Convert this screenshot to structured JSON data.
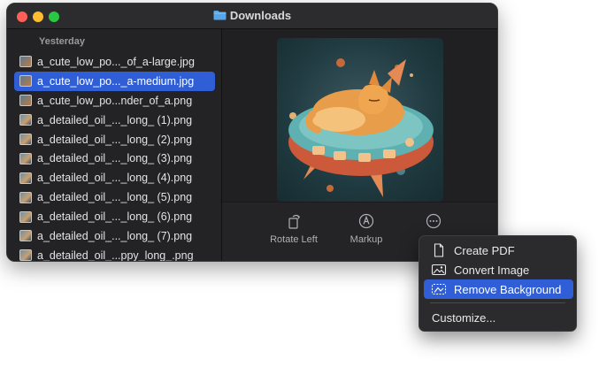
{
  "window": {
    "title": "Downloads"
  },
  "sidebar": {
    "section": "Yesterday",
    "files": [
      {
        "name": "a_cute_low_po..._of_a-large.jpg",
        "selected": false,
        "thumb": "cat"
      },
      {
        "name": "a_cute_low_po..._a-medium.jpg",
        "selected": true,
        "thumb": "cat"
      },
      {
        "name": "a_cute_low_po...nder_of_a.png",
        "selected": false,
        "thumb": "cat"
      },
      {
        "name": "a_detailed_oil_..._long_ (1).png",
        "selected": false,
        "thumb": "oil"
      },
      {
        "name": "a_detailed_oil_..._long_ (2).png",
        "selected": false,
        "thumb": "oil"
      },
      {
        "name": "a_detailed_oil_..._long_ (3).png",
        "selected": false,
        "thumb": "oil"
      },
      {
        "name": "a_detailed_oil_..._long_ (4).png",
        "selected": false,
        "thumb": "oil"
      },
      {
        "name": "a_detailed_oil_..._long_ (5).png",
        "selected": false,
        "thumb": "oil"
      },
      {
        "name": "a_detailed_oil_..._long_ (6).png",
        "selected": false,
        "thumb": "oil"
      },
      {
        "name": "a_detailed_oil_..._long_ (7).png",
        "selected": false,
        "thumb": "oil"
      },
      {
        "name": "a_detailed_oil_...ppy_long_.png",
        "selected": false,
        "thumb": "oil"
      }
    ]
  },
  "preview": {
    "image_icon": "cat-on-spaceship-illustration"
  },
  "toolbar": {
    "rotate_left": "Rotate Left",
    "markup": "Markup",
    "more": "M"
  },
  "menu": {
    "create_pdf": "Create PDF",
    "convert_image": "Convert Image",
    "remove_background": "Remove Background",
    "customize": "Customize..."
  },
  "colors": {
    "accent": "#2f5ed6",
    "window_bg": "#1e1e1f",
    "close": "#ff5f57",
    "minimize": "#febc2e",
    "maximize": "#28c840",
    "folder": "#58a6e8"
  }
}
